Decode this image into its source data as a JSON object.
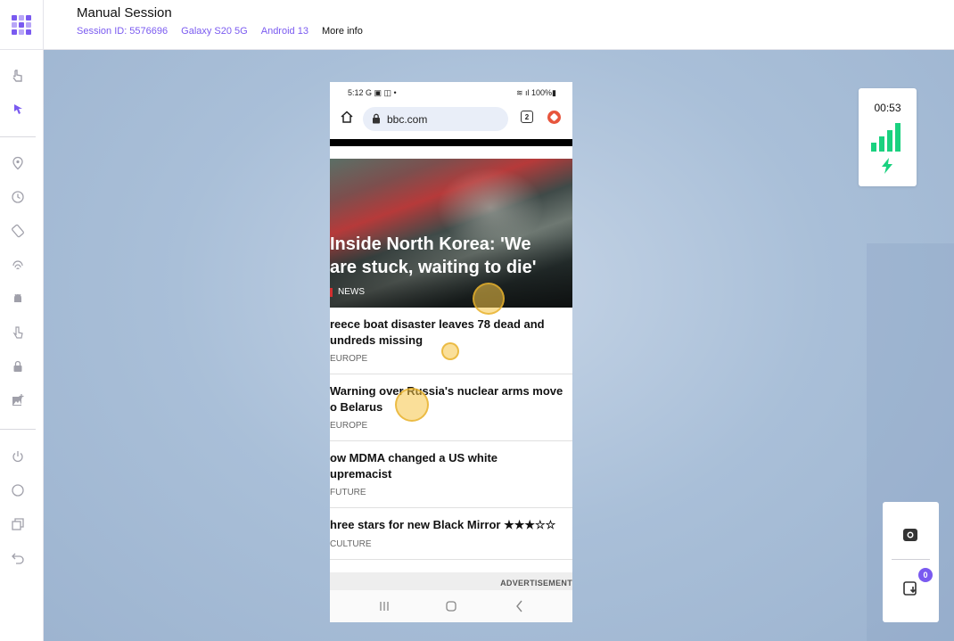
{
  "header": {
    "title": "Manual Session",
    "session_id": "Session ID: 5576696",
    "device": "Galaxy S20 5G",
    "os": "Android 13",
    "more_info": "More info"
  },
  "sidebar": {
    "items": [
      {
        "icon": "tap-gesture-icon"
      },
      {
        "icon": "interact-cursor-icon",
        "active": true
      },
      {
        "icon": "location-pin-icon"
      },
      {
        "icon": "clock-icon"
      },
      {
        "icon": "rotate-device-icon"
      },
      {
        "icon": "fingerprint-icon"
      },
      {
        "icon": "android-icon"
      },
      {
        "icon": "touch-icon"
      },
      {
        "icon": "lock-icon"
      },
      {
        "icon": "image-add-icon"
      },
      {
        "icon": "power-icon"
      },
      {
        "icon": "home-circle-icon"
      },
      {
        "icon": "recent-apps-icon"
      },
      {
        "icon": "back-icon"
      }
    ]
  },
  "phone": {
    "status": {
      "time": "5:12",
      "notification_icons": "G ▣ ◫ •",
      "battery": "100%"
    },
    "browser": {
      "url": "bbc.com",
      "tab_count": "2"
    },
    "hero": {
      "title_line1": "Inside North Korea: 'We",
      "title_line2": "are stuck, waiting to die'",
      "tag": "NEWS"
    },
    "articles": [
      {
        "line1": "reece boat disaster leaves 78 dead and",
        "line2": "undreds missing",
        "category": "EUROPE"
      },
      {
        "line1": "Warning over Russia's nuclear arms move",
        "line2": "o Belarus",
        "category": "EUROPE"
      },
      {
        "line1": "ow MDMA changed a US white",
        "line2": "upremacist",
        "category": "FUTURE"
      },
      {
        "line1": "hree stars for new Black Mirror ★★★☆☆",
        "line2": "",
        "category": "CULTURE"
      }
    ],
    "ad_label": "ADVERTISEMENT"
  },
  "network": {
    "timer": "00:53",
    "signal_color": "#1ad17f"
  },
  "actions": {
    "downloads_count": "0"
  },
  "colors": {
    "accent": "#7a5af0",
    "stage_bg": "#a9bfd8",
    "touch_marker": "#f5c446"
  }
}
